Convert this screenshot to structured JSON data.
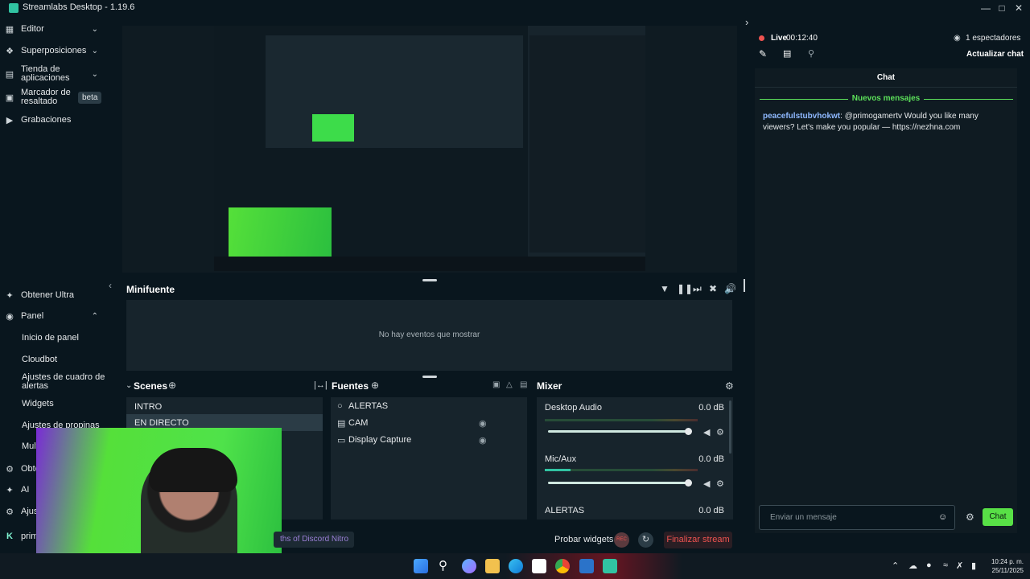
{
  "window": {
    "title": "Streamlabs Desktop - 1.19.6"
  },
  "sidebar": {
    "top_items": [
      {
        "label": "Editor"
      },
      {
        "label": "Superposiciones"
      },
      {
        "label": "Tienda de\naplicaciones"
      },
      {
        "label": "Marcador de\nresaltado",
        "badge": "beta"
      },
      {
        "label": "Grabaciones"
      }
    ],
    "bottom_items": {
      "ultra": "Obtener Ultra",
      "panel": "Panel",
      "panel_sub": [
        "Inicio de panel",
        "Cloudbot",
        "Ajustes de cuadro de\nalertas",
        "Widgets",
        "Ajustes de propinas",
        "Mult"
      ],
      "obte": "Obte",
      "ai": "AI",
      "ajust": "Ajust",
      "prim": "prim"
    }
  },
  "minifuente": {
    "title": "Minifuente",
    "empty": "No hay eventos que mostrar"
  },
  "scenes": {
    "title": "Scenes",
    "items": [
      "INTRO",
      "EN DIRECTO"
    ]
  },
  "sources": {
    "title": "Fuentes",
    "items": [
      "ALERTAS",
      "CAM",
      "Display Capture"
    ]
  },
  "mixer": {
    "title": "Mixer",
    "channels": [
      {
        "name": "Desktop Audio",
        "db": "0.0 dB"
      },
      {
        "name": "Mic/Aux",
        "db": "0.0 dB"
      },
      {
        "name": "ALERTAS",
        "db": "0.0 dB"
      }
    ]
  },
  "footer": {
    "promo": "ths of Discord Nitro",
    "test_widgets": "Probar widgets",
    "rec": "REC",
    "end_stream": "Finalizar stream"
  },
  "live": {
    "label": "Live",
    "time": "00:12:40",
    "viewers": "1 espectadores",
    "refresh_chat": "Actualizar chat"
  },
  "chat": {
    "title": "Chat",
    "new_messages": "Nuevos mensajes",
    "messages": [
      {
        "user": "peacefulstubvhokwt",
        "text": ": @primogamertv Would you like many viewers? Let's make you popular — https://nezhna.com"
      }
    ],
    "input_placeholder": "Enviar un mensaje",
    "send_label": "Chat"
  },
  "taskbar": {
    "time": "10:24 p. m.",
    "date": "25/11/2025"
  },
  "colors": {
    "accent": "#80f5d2",
    "live_red": "#ef5350",
    "green_text": "#5ce05a",
    "username": "#8fb9ff"
  }
}
